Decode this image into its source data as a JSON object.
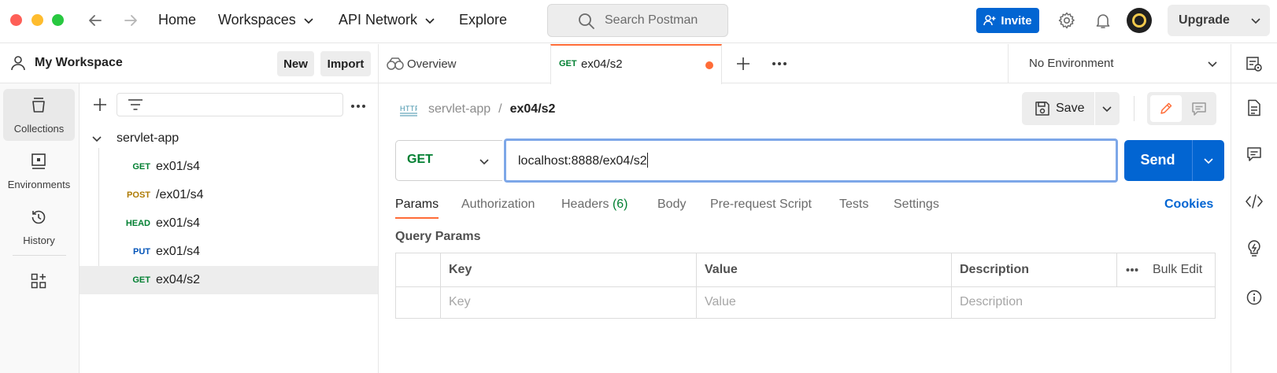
{
  "colors": {
    "accent_orange": "#ff6c37",
    "primary_blue": "#0265d2",
    "method_get": "#007f31",
    "method_post": "#ad7a03",
    "method_head": "#007f31",
    "method_put": "#0053b8"
  },
  "topbar": {
    "nav": {
      "home": "Home",
      "workspaces": "Workspaces",
      "api_network": "API Network",
      "explore": "Explore"
    },
    "search_placeholder": "Search Postman",
    "invite": "Invite",
    "upgrade": "Upgrade"
  },
  "workspace": {
    "name": "My Workspace",
    "new_label": "New",
    "import_label": "Import"
  },
  "rail": [
    {
      "label": "Collections",
      "icon": "collections-icon"
    },
    {
      "label": "Environments",
      "icon": "environments-icon"
    },
    {
      "label": "History",
      "icon": "history-icon"
    }
  ],
  "collection": {
    "name": "servlet-app",
    "requests": [
      {
        "method": "GET",
        "name": "ex01/s4"
      },
      {
        "method": "POST",
        "name": "/ex01/s4"
      },
      {
        "method": "HEAD",
        "name": "ex01/s4"
      },
      {
        "method": "PUT",
        "name": "ex01/s4"
      },
      {
        "method": "GET",
        "name": "ex04/s2"
      }
    ]
  },
  "tabs": {
    "overview": "Overview",
    "active": {
      "method": "GET",
      "name": "ex04/s2"
    },
    "environment": "No Environment"
  },
  "request": {
    "breadcrumb_collection": "servlet-app",
    "breadcrumb_sep": "/",
    "breadcrumb_name": "ex04/s2",
    "save": "Save",
    "method": "GET",
    "url": "localhost:8888/ex04/s2",
    "send": "Send",
    "tabs": {
      "params": "Params",
      "authorization": "Authorization",
      "headers": "Headers",
      "headers_count": "(6)",
      "body": "Body",
      "prerequest": "Pre-request Script",
      "tests": "Tests",
      "settings": "Settings"
    },
    "cookies": "Cookies",
    "query_params_title": "Query Params",
    "table": {
      "key": "Key",
      "value": "Value",
      "description": "Description",
      "bulk_edit": "Bulk Edit",
      "key_placeholder": "Key",
      "value_placeholder": "Value",
      "description_placeholder": "Description"
    }
  }
}
